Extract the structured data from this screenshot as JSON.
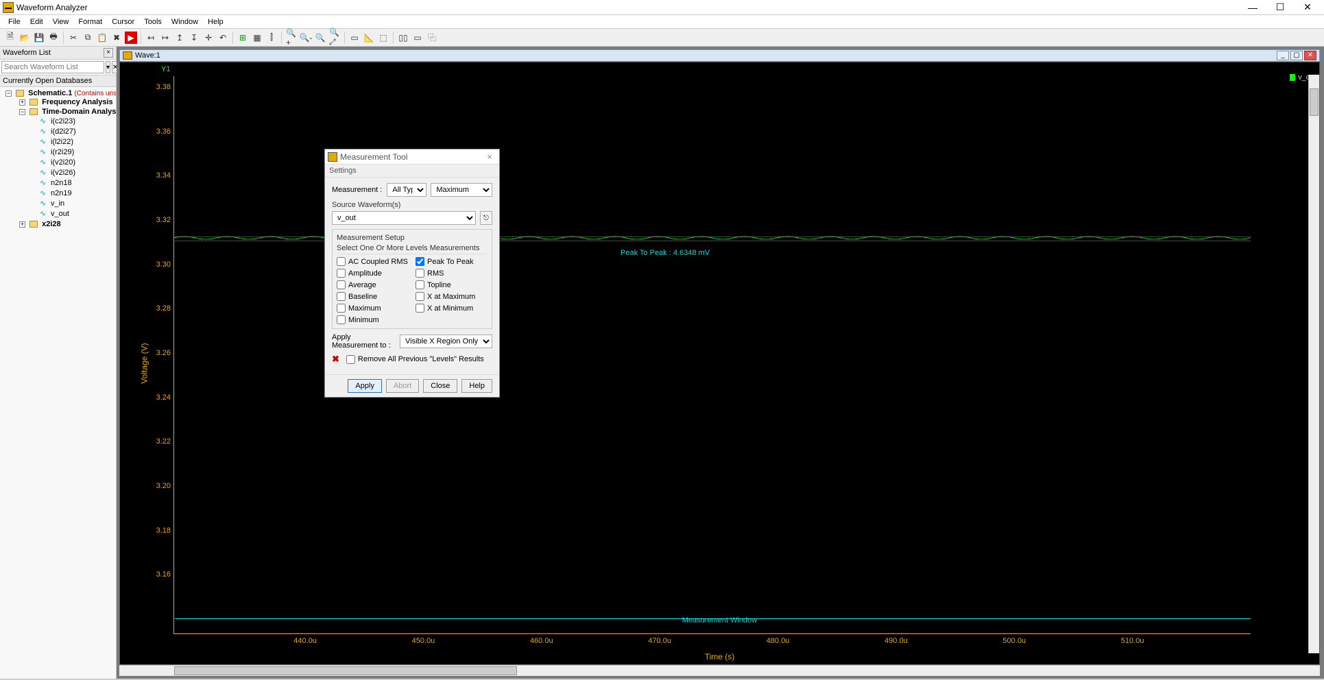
{
  "app": {
    "title": "Waveform Analyzer"
  },
  "menubar": [
    "File",
    "Edit",
    "View",
    "Format",
    "Cursor",
    "Tools",
    "Window",
    "Help"
  ],
  "sidebar": {
    "panel_title": "Waveform List",
    "search_placeholder": "Search Waveform List",
    "db_header": "Currently Open Databases",
    "tree_root": "Schematic.1",
    "tree_root_note": "(Contains unsav",
    "freq_node": "Frequency Analysis",
    "time_node": "Time-Domain Analysis",
    "signals": [
      "i(c2i23)",
      "i(d2i27)",
      "i(l2i22)",
      "i(r2i29)",
      "i(v2i20)",
      "i(v2i26)",
      "n2n18",
      "n2n19",
      "v_in",
      "v_out"
    ],
    "extra_node": "x2i28"
  },
  "doc": {
    "title": "Wave:1"
  },
  "plot": {
    "y1_label": "Y1",
    "y_axis_label": "Voltage (V)",
    "x_axis_label": "Time (s)",
    "y_ticks": [
      "3.38",
      "3.36",
      "3.34",
      "3.32",
      "3.30",
      "3.28",
      "3.26",
      "3.24",
      "3.22",
      "3.20",
      "3.18",
      "3.16"
    ],
    "x_ticks": [
      "440.0u",
      "450.0u",
      "460.0u",
      "470.0u",
      "480.0u",
      "490.0u",
      "500.0u",
      "510.0u"
    ],
    "measure_text": "Peak To Peak : 4.6348 mV",
    "measure_window_label": "Measurement Window",
    "legend": "v_out"
  },
  "dialog": {
    "title": "Measurement Tool",
    "menu": "Settings",
    "measurement_label": "Measurement :",
    "type_select": "All Types",
    "sub_select": "Maximum",
    "source_label": "Source Waveform(s)",
    "source_value": "v_out",
    "setup_label": "Measurement Setup",
    "sub_legend": "Select One Or More Levels Measurements",
    "checks_left": [
      "AC Coupled RMS",
      "Amplitude",
      "Average",
      "Baseline",
      "Maximum",
      "Minimum"
    ],
    "checks_right": [
      "Peak To Peak",
      "RMS",
      "Topline",
      "X at Maximum",
      "X at Minimum"
    ],
    "checked": "Peak To Peak",
    "apply_to_label": "Apply Measurement to :",
    "apply_to_value": "Visible X Region Only",
    "remove_label": "Remove All Previous \"Levels\" Results",
    "btn_apply": "Apply",
    "btn_abort": "Abort",
    "btn_close": "Close",
    "btn_help": "Help"
  }
}
